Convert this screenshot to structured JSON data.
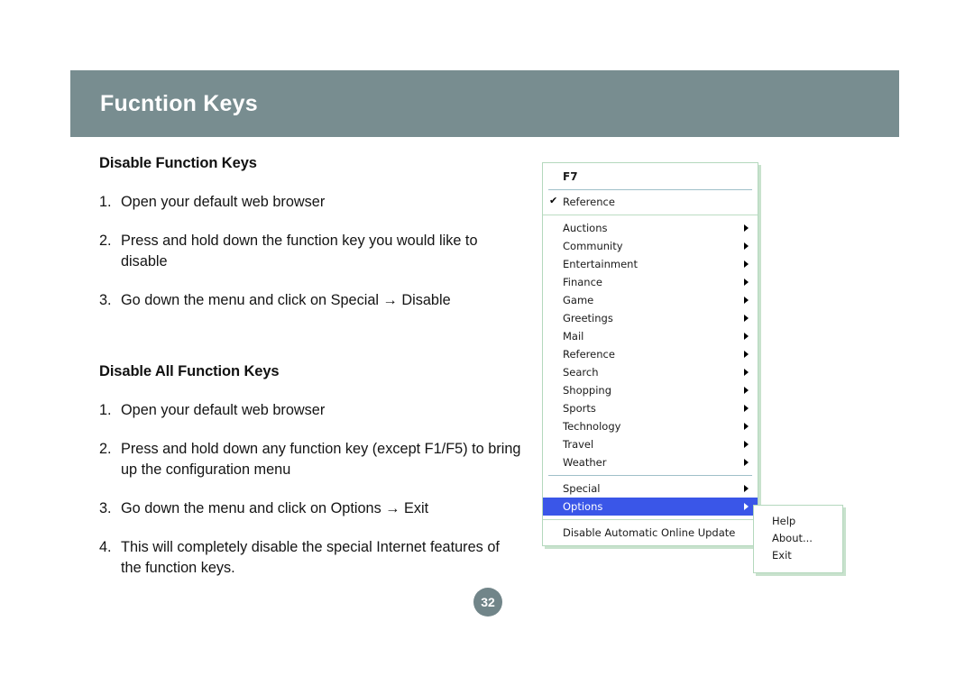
{
  "header": {
    "title": "Fucntion Keys"
  },
  "page": {
    "number": "32"
  },
  "sections": [
    {
      "heading": "Disable Function Keys",
      "steps": [
        {
          "num": "1.",
          "text": "Open your default web browser"
        },
        {
          "num": "2.",
          "text": "Press and hold down the function key you would like to disable"
        },
        {
          "num": "3.",
          "text": "Go down the menu and click on Special → Disable"
        }
      ]
    },
    {
      "heading": "Disable All Function Keys",
      "steps": [
        {
          "num": "1.",
          "text": "Open your default web browser"
        },
        {
          "num": "2.",
          "text": "Press and hold down any function key (except F1/F5) to bring up the configuration menu"
        },
        {
          "num": "3.",
          "text": "Go down the menu and click on Options → Exit"
        },
        {
          "num": "4.",
          "text": "This will completely disable the special Internet features of the function keys."
        }
      ]
    }
  ],
  "context_menu": {
    "title": "F7",
    "checked_item": {
      "label": "Reference",
      "check_glyph": "✔"
    },
    "categories": [
      {
        "label": "Auctions",
        "submenu": true
      },
      {
        "label": "Community",
        "submenu": true
      },
      {
        "label": "Entertainment",
        "submenu": true
      },
      {
        "label": "Finance",
        "submenu": true
      },
      {
        "label": "Game",
        "submenu": true
      },
      {
        "label": "Greetings",
        "submenu": true
      },
      {
        "label": "Mail",
        "submenu": true
      },
      {
        "label": "Reference",
        "submenu": true
      },
      {
        "label": "Search",
        "submenu": true
      },
      {
        "label": "Shopping",
        "submenu": true
      },
      {
        "label": "Sports",
        "submenu": true
      },
      {
        "label": "Technology",
        "submenu": true
      },
      {
        "label": "Travel",
        "submenu": true
      },
      {
        "label": "Weather",
        "submenu": true
      }
    ],
    "actions": [
      {
        "label": "Special",
        "submenu": true,
        "selected": false
      },
      {
        "label": "Options",
        "submenu": true,
        "selected": true
      }
    ],
    "footer_item": {
      "label": "Disable Automatic Online Update",
      "submenu": false
    },
    "submenu": {
      "items": [
        {
          "label": "Help"
        },
        {
          "label": "About..."
        },
        {
          "label": "Exit"
        }
      ]
    },
    "colors": {
      "highlight": "#3a56e8",
      "border": "#b4d8bd",
      "shadow": "#c8e2cd"
    }
  },
  "colors": {
    "header_bar": "#788d90",
    "page_badge": "#718589",
    "text": "#141414"
  }
}
